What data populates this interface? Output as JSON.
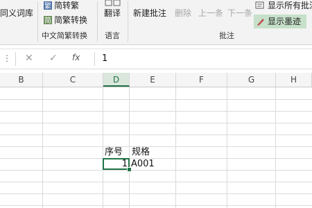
{
  "ribbon": {
    "cut_label": "同义词库",
    "trad_to_simp": "简转繁",
    "simp_to_trad": "简繁转换",
    "group_chinese": "中文简繁转换",
    "translate": "翻译",
    "group_language": "语言",
    "new_comment": "新建批注",
    "delete": "删除",
    "previous": "上一条",
    "next": "下一条",
    "show_all_comments": "显示所有批注",
    "show_ink": "显示墨迹",
    "group_comments": "批注"
  },
  "formula_bar": {
    "value": "1",
    "cancel_icon": "✕",
    "enter_icon": "✓",
    "fx_label": "fx"
  },
  "columns": [
    "B",
    "C",
    "D",
    "E",
    "F",
    "G",
    "H"
  ],
  "selected_column": "D",
  "cells": {
    "d_header": "序号",
    "e_header": "规格",
    "d_value": "1",
    "e_value": "A001"
  },
  "colors": {
    "accent": "#217346",
    "ribbon_bg": "#f3f3f3",
    "active_toggle": "#c6e0c9"
  }
}
